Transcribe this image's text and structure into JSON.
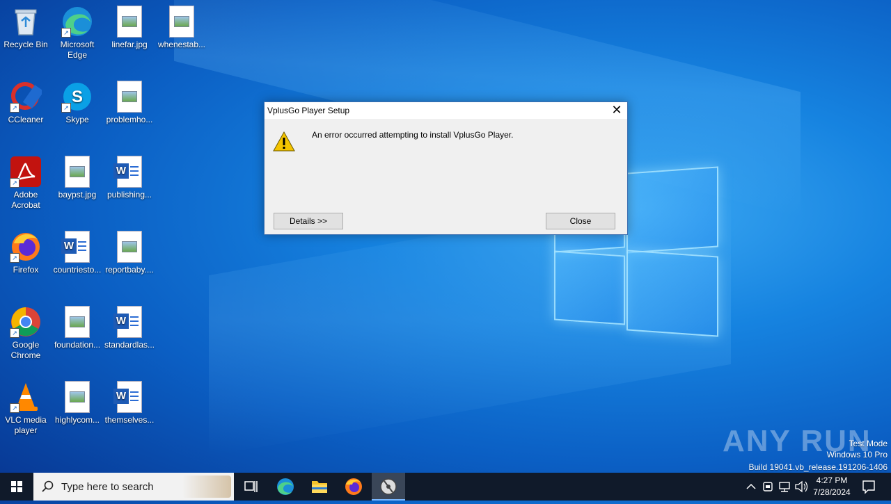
{
  "desktop": {
    "icons": [
      {
        "label": "Recycle Bin"
      },
      {
        "label": "Microsoft Edge"
      },
      {
        "label": "linefar.jpg"
      },
      {
        "label": "whenestab..."
      },
      {
        "label": "CCleaner"
      },
      {
        "label": "Skype"
      },
      {
        "label": "problemho..."
      },
      {
        "label": "Adobe Acrobat"
      },
      {
        "label": "baypst.jpg"
      },
      {
        "label": "publishing..."
      },
      {
        "label": "Firefox"
      },
      {
        "label": "countriesto..."
      },
      {
        "label": "reportbaby...."
      },
      {
        "label": "Google Chrome"
      },
      {
        "label": "foundation..."
      },
      {
        "label": "standardlas..."
      },
      {
        "label": "VLC media player"
      },
      {
        "label": "highlycom..."
      },
      {
        "label": "themselves..."
      }
    ]
  },
  "dialog": {
    "title": "VplusGo Player Setup",
    "message": "An error occurred attempting to install VplusGo Player.",
    "details_label": "Details >>",
    "close_label": "Close"
  },
  "watermark": {
    "brand": "ANY RUN",
    "line1": "Test Mode",
    "line2": "Windows 10 Pro",
    "line3": "Build 19041.vb_release.191206-1406"
  },
  "taskbar": {
    "search_placeholder": "Type here to search",
    "time": "4:27 PM",
    "date": "7/28/2024"
  },
  "colors": {
    "accent": "#0b5fc4",
    "taskbar": "#101a2a",
    "dialog_bg": "#f0f0f0"
  }
}
